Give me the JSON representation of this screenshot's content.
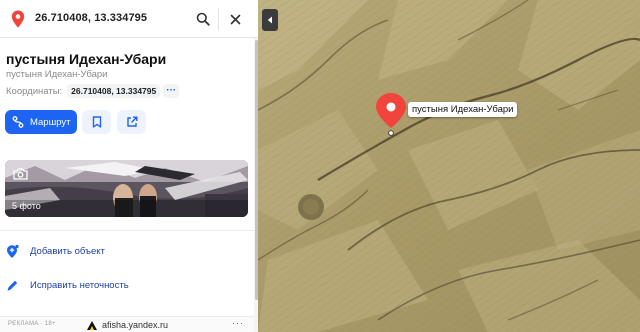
{
  "search": {
    "value": "26.710408, 13.334795",
    "icons": {
      "pin": "location-pin-icon",
      "search": "search-icon",
      "close": "close-icon"
    }
  },
  "place": {
    "title": "пустыня Идехан-Убари",
    "subtitle": "пустыня Идехан-Убари",
    "coords_label": "Координаты:",
    "coords_value": "26.710408, 13.334795"
  },
  "actions": {
    "route_label": "Маршрут",
    "add_object": "Добавить объект",
    "fix_error": "Исправить неточность"
  },
  "photos": {
    "count_label": "5 фото"
  },
  "ad": {
    "label": "РЕКЛАМА · 18+",
    "text": "afisha.yandex.ru"
  },
  "map": {
    "marker_label": "пустыня Идехан-Убари"
  },
  "colors": {
    "accent": "#1d64f2",
    "marker": "#f0443d",
    "link": "#1a3fa8",
    "sand": "#b0a171"
  }
}
